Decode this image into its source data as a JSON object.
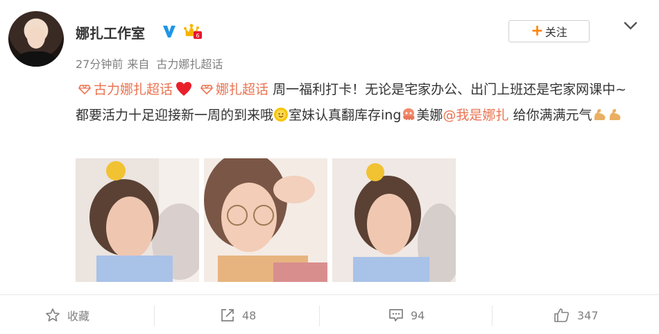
{
  "post": {
    "author": "娜扎工作室",
    "time": "27分钟前",
    "from_label": "来自",
    "source": "古力娜扎超话",
    "follow_label": "关注",
    "content": {
      "topic1": "古力娜扎超话",
      "topic2": "娜扎超话",
      "text1": "周一福利打卡！无论是宅家办公、出门上班还是宅家网课中~都要活力十足迎接新一周的到来哦",
      "text2": "室妹认真翻库存ing",
      "text3": "美娜",
      "mention": "@我是娜扎",
      "text4": "给你满满元气"
    }
  },
  "actions": {
    "favorite_label": "收藏",
    "repost_count": "48",
    "comment_count": "94",
    "like_count": "347"
  },
  "colors": {
    "accent": "#ff8200",
    "link": "#eb7350",
    "verified": "#1e96e6"
  }
}
